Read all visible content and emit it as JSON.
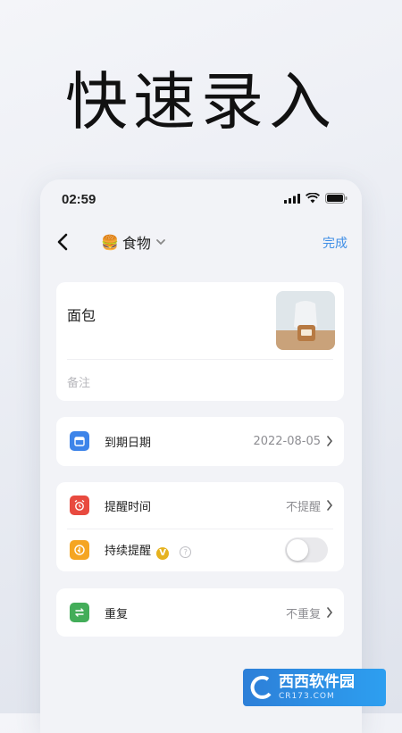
{
  "hero": {
    "title": "快速录入"
  },
  "status_bar": {
    "time": "02:59"
  },
  "nav": {
    "category_emoji": "🍔",
    "category_label": "食物",
    "done_label": "完成"
  },
  "item": {
    "name": "面包",
    "note_placeholder": "备注"
  },
  "rows": {
    "expiry": {
      "label": "到期日期",
      "value": "2022-08-05"
    },
    "reminder": {
      "label": "提醒时间",
      "value": "不提醒"
    },
    "persistent": {
      "label": "持续提醒",
      "vip_badge": "V",
      "toggle_on": false
    },
    "repeat": {
      "label": "重复",
      "value": "不重复"
    }
  },
  "watermark": {
    "text": "西西软件园",
    "sub": "CR173.COM"
  },
  "colors": {
    "accent": "#3f8ee6",
    "calendar": "#3d84e9",
    "alarm": "#e84a3f",
    "persistent": "#f5a522",
    "repeat": "#43ad59",
    "vip": "#e6b21e"
  }
}
